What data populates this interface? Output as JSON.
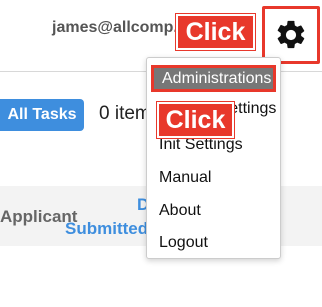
{
  "header": {
    "user_email": "james@allcomp...",
    "gear_icon": "gear-icon"
  },
  "toolbar": {
    "all_tasks_label": "All Tasks",
    "items_count": "0 item"
  },
  "table": {
    "columns": {
      "applicant": "Applicant",
      "submitted": "Submitted",
      "date": "D"
    }
  },
  "menu": {
    "items": [
      {
        "label": "Administrations"
      },
      {
        "label": "Domain Settings"
      },
      {
        "label": "Init Settings"
      },
      {
        "label": "Manual"
      },
      {
        "label": "About"
      },
      {
        "label": "Logout"
      }
    ]
  },
  "annotations": {
    "click_label_1": "Click",
    "click_label_2": "Click"
  },
  "colors": {
    "accent_blue": "#3e8ede",
    "annotation_red": "#e8382b",
    "menu_highlight": "#777777"
  }
}
